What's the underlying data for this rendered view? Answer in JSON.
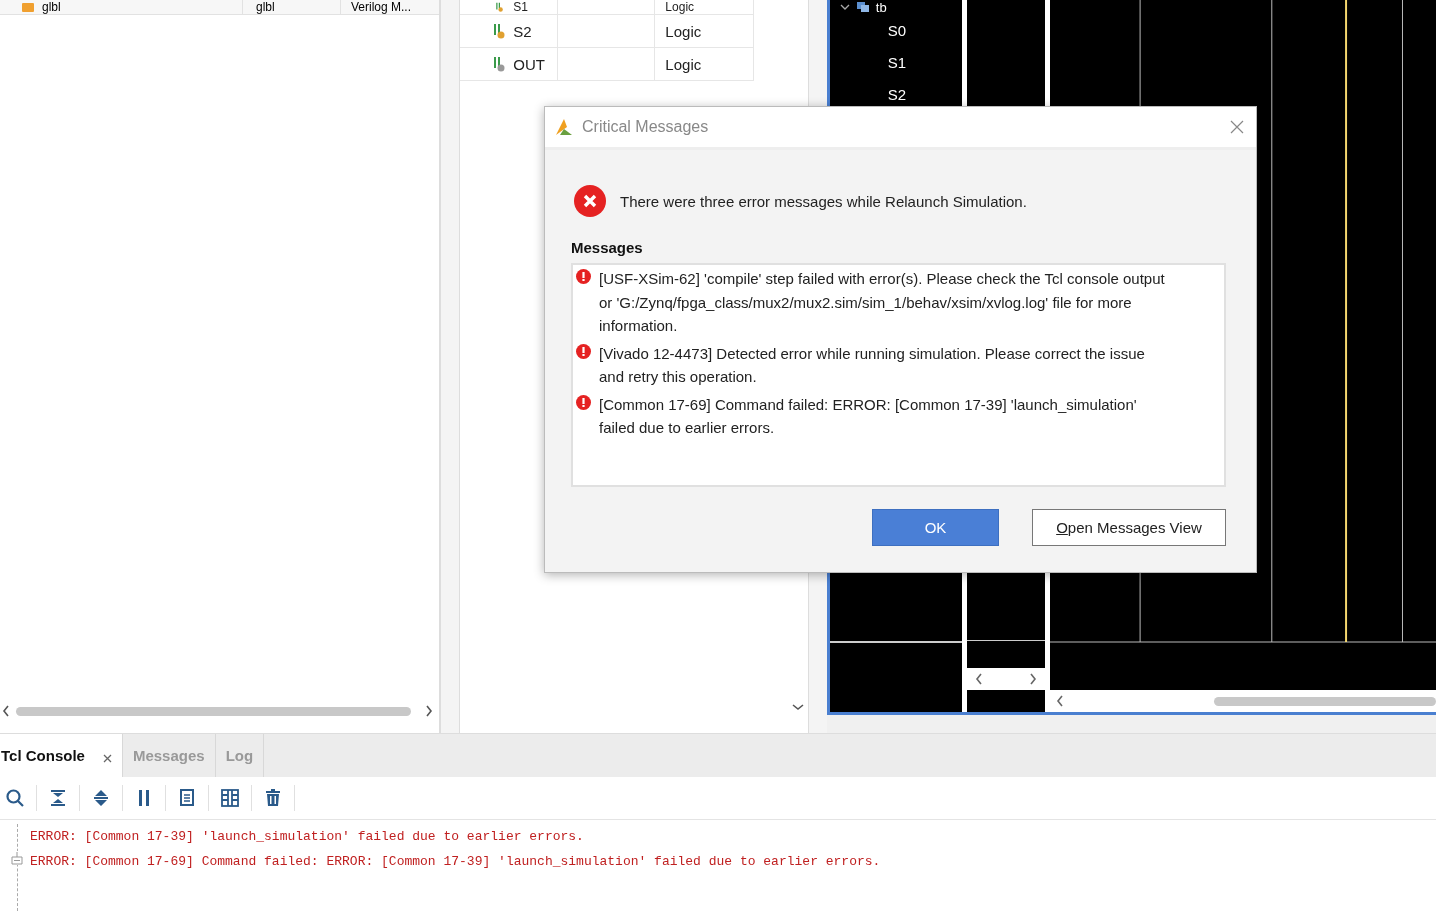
{
  "sources_table": {
    "row": {
      "name": "glbl",
      "library": "glbl",
      "type": "Verilog M..."
    }
  },
  "objects_table": {
    "rows": [
      {
        "name": "S1",
        "type": "Logic"
      },
      {
        "name": "S2",
        "type": "Logic"
      },
      {
        "name": "OUT",
        "type": "Logic"
      }
    ]
  },
  "waveform": {
    "tree": [
      {
        "label": "tb",
        "expanded": true,
        "children": [
          {
            "label": "S0"
          },
          {
            "label": "S1"
          },
          {
            "label": "S2"
          }
        ]
      }
    ]
  },
  "dialog": {
    "title": "Critical Messages",
    "summary": "There were three error messages while Relaunch Simulation.",
    "section": "Messages",
    "messages": [
      "[USF-XSim-62] 'compile' step failed with error(s). Please check the Tcl console output or 'G:/Zynq/fpga_class/mux2/mux2.sim/sim_1/behav/xsim/xvlog.log' file for more information.",
      "[Vivado 12-4473] Detected error while running simulation. Please correct the issue and retry this operation.",
      "[Common 17-69] Command failed: ERROR: [Common 17-39] 'launch_simulation' failed due to earlier errors."
    ],
    "buttons": [
      {
        "label": "OK",
        "kind": "primary"
      },
      {
        "label": "Open Messages View",
        "kind": "secondary"
      }
    ]
  },
  "console": {
    "tabs": [
      {
        "label": "Tcl Console",
        "selected": true
      },
      {
        "label": "Messages",
        "selected": false
      },
      {
        "label": "Log",
        "selected": false
      }
    ],
    "lines": [
      "ERROR: [Common 17-39] 'launch_simulation' failed due to earlier errors.",
      "ERROR: [Common 17-69] Command failed: ERROR: [Common 17-39] 'launch_simulation' failed due to earlier errors."
    ]
  }
}
